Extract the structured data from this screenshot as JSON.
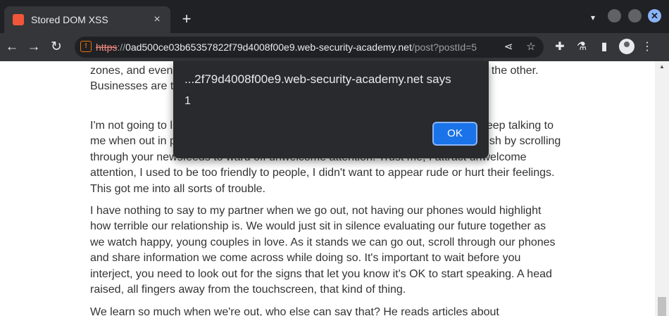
{
  "browser": {
    "tab_title": "Stored DOM XSS",
    "new_tab_label": "+",
    "url": {
      "scheme": "https",
      "separator": "://",
      "host": "0ad500ce03b65357822f79d4008f00e9.web-security-academy.net",
      "path": "/post?postId=5"
    }
  },
  "icons": {
    "back": "←",
    "forward": "→",
    "reload": "↻",
    "close_tab": "×",
    "tab_search": "▾",
    "share": "⋖",
    "bookmark": "☆",
    "extensions": "✚",
    "labs": "⚗",
    "side_panel": "▮",
    "menu": "⋮",
    "window_close": "✕",
    "scroll_up": "▲"
  },
  "colors": {
    "tab_strip": "#202124",
    "toolbar": "#35363a",
    "dialog_bg": "#292a2d",
    "ok_button": "#1a73e8",
    "body_text": "#333333",
    "not_secure": "#f28b82"
  },
  "article": {
    "paragraphs": [
      "zones, and even we go out in public. We give with one hand and take away with the other. Businesses are trying hard to get us to watch.",
      "I'm not going to lie, when I'm out with the family I do find it hard to talk. People keep talking to me when out in public. So I've become good at the blank stare, which I accomplish by scrolling through your newsfeeds to ward off unwelcome attention. Trust me, I attract unwelcome attention, I used to be too friendly to people, I didn't want to appear rude or hurt their feelings. This got me into all sorts of trouble.",
      "I have nothing to say to my partner when we go out, not having our phones would highlight how terrible our relationship is. We would just sit in silence evaluating our future together as we watch happy, young couples in love. As it stands we can go out, scroll through our phones and share information we come across while doing so. It's important to wait before you interject, you need to look out for the signs that let you know it's OK to start speaking. A head raised, all fingers away from the touchscreen, that kind of thing.",
      "We learn so much when we're out, who else can say that? He reads articles about"
    ]
  },
  "alert_dialog": {
    "title": "...2f79d4008f00e9.web-security-academy.net says",
    "message": "1",
    "ok_label": "OK"
  }
}
